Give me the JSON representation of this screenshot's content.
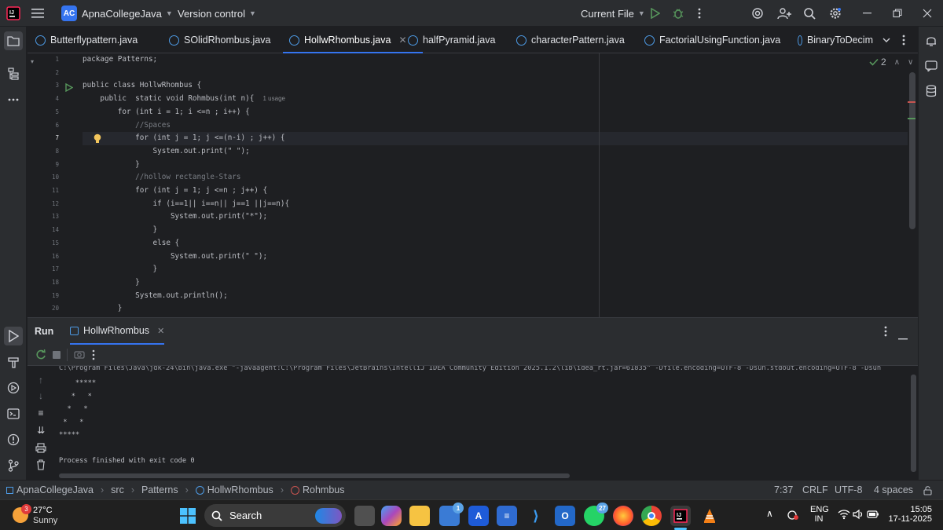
{
  "titlebar": {
    "project_badge": "AC",
    "project_name": "ApnaCollegeJava",
    "vcs": "Version control",
    "run_config": "Current File",
    "icons": [
      "app-logo-icon",
      "hamburger-menu-icon",
      "run-icon",
      "debug-icon",
      "more-vertical-icon",
      "ai-assistant-icon",
      "add-user-icon",
      "search-icon",
      "settings-icon",
      "minimize-icon",
      "restore-icon",
      "close-icon"
    ]
  },
  "tabs": [
    {
      "label": "Butterflypattern.java",
      "active": false,
      "modified": false
    },
    {
      "label": "SOlidRhombus.java",
      "active": false,
      "modified": false
    },
    {
      "label": "HollwRhombus.java",
      "active": true,
      "modified": true
    },
    {
      "label": "halfPyramid.java",
      "active": false,
      "modified": false
    },
    {
      "label": "characterPattern.java",
      "active": false,
      "modified": false
    },
    {
      "label": "FactorialUsingFunction.java",
      "active": false,
      "modified": false
    },
    {
      "label": "BinaryToDecim",
      "active": false,
      "modified": false
    }
  ],
  "editor": {
    "inspection_count": "2",
    "usage_hint": "1 usage",
    "line_numbers": [
      "1",
      "2",
      "3",
      "4",
      "5",
      "6",
      "7",
      "8",
      "9",
      "10",
      "11",
      "12",
      "13",
      "14",
      "15",
      "16",
      "17",
      "18",
      "19",
      "20"
    ],
    "lines": [
      "package Patterns;",
      "",
      "public class HollwRhombus {",
      "    public  static void Rohmbus(int n){",
      "        for (int i = 1; i <=n ; i++) {",
      "            //Spaces",
      "            for (int j = 1; j <=(n-i) ; j++) {",
      "                System.out.print(\" \");",
      "            }",
      "            //hollow rectangle-Stars",
      "            for (int j = 1; j <=n ; j++) {",
      "                if (i==1|| i==n|| j==1 ||j==n){",
      "                    System.out.print(\"*\");",
      "                }",
      "                else {",
      "                    System.out.print(\" \");",
      "                }",
      "            }",
      "            System.out.println();",
      "        }"
    ]
  },
  "run": {
    "panel_title": "Run",
    "tab_label": "HollwRhombus",
    "output": [
      "C:\\Program Files\\Java\\jdk-24\\bin\\java.exe \"-javaagent:C:\\Program Files\\JetBrains\\IntelliJ IDEA Community Edition 2025.1.2\\lib\\idea_rt.jar=61835\" -Dfile.encoding=UTF-8 -Dsun.stdout.encoding=UTF-8 -Dsun",
      "    *****",
      "   *   *",
      "  *   *",
      " *   *",
      "*****",
      "",
      "Process finished with exit code 0"
    ]
  },
  "statusbar": {
    "breadcrumbs": [
      "ApnaCollegeJava",
      "src",
      "Patterns",
      "HollwRhombus",
      "Rohmbus"
    ],
    "position": "7:37",
    "line_sep": "CRLF",
    "encoding": "UTF-8",
    "indent": "4 spaces"
  },
  "taskbar": {
    "weather_temp": "27°C",
    "weather_desc": "Sunny",
    "weather_badge": "3",
    "search_label": "Search",
    "lang": "ENG",
    "region": "IN",
    "time": "15:05",
    "date": "17-11-2025",
    "whatsapp_badge": "27",
    "store_badge": "1"
  },
  "colors": {
    "accent": "#3574f0",
    "run_green": "#57965c",
    "background": "#1e1f22",
    "panel": "#2b2d30"
  }
}
